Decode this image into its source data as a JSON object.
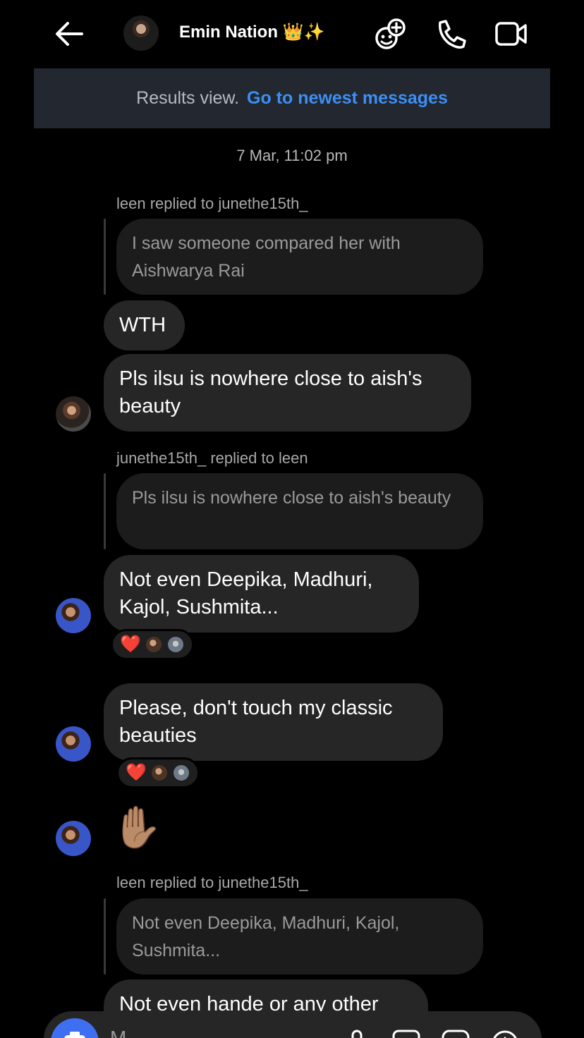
{
  "header": {
    "chat_name": "Emin Nation 👑✨"
  },
  "banner": {
    "label": "Results view.",
    "link": "Go to newest messages"
  },
  "timestamp": "7 Mar, 11:02 pm",
  "messages": [
    {
      "reply_label": "leen replied to junethe15th_",
      "quote": "I saw someone compared her with Aishwarya Rai"
    },
    {
      "text": "WTH"
    },
    {
      "text": "Pls ilsu is nowhere close to aish's beauty"
    },
    {
      "reply_label": "junethe15th_ replied to leen",
      "quote": "Pls ilsu is nowhere close to aish's beauty"
    },
    {
      "text": "Not even Deepika, Madhuri, Kajol, Sushmita..."
    },
    {
      "text": "Please, don't touch my classic beauties"
    },
    {
      "emoji": "✋🏽"
    },
    {
      "reply_label": "leen replied to junethe15th_",
      "quote": "Not even Deepika, Madhuri, Kajol, Sushmita..."
    },
    {
      "text": "Not even hande or any other"
    }
  ],
  "reactions": {
    "emoji": "❤️"
  },
  "composer": {
    "placeholder": "M"
  },
  "icons": [
    "back-arrow-icon",
    "add-people-icon",
    "phone-icon",
    "video-camera-icon",
    "camera-icon",
    "microphone-icon",
    "gallery-icon",
    "sticker-icon",
    "plus-icon"
  ],
  "colors": {
    "link": "#3b8ff6",
    "bubble": "#262626",
    "banner": "#23272f",
    "camera": "#3e6ff0",
    "heart": "#ff1f3d"
  }
}
